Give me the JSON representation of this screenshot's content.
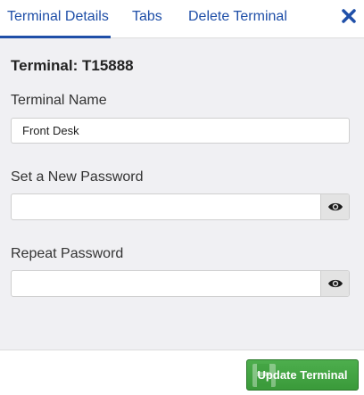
{
  "tabs": [
    {
      "label": "Terminal Details",
      "active": true
    },
    {
      "label": "Tabs",
      "active": false
    },
    {
      "label": "Delete Terminal",
      "active": false
    }
  ],
  "close_icon": "close-icon",
  "terminal_title": "Terminal: T15888",
  "form": {
    "name_label": "Terminal Name",
    "name_value": "Front Desk",
    "password_label": "Set a New Password",
    "password_value": "",
    "repeat_label": "Repeat Password",
    "repeat_value": "",
    "eye_icon": "eye-icon"
  },
  "footer": {
    "update_label": "Update Terminal"
  },
  "colors": {
    "accent": "#1f4fa8",
    "button_green": "#3a9a3a",
    "panel_bg": "#f0f0f3"
  }
}
